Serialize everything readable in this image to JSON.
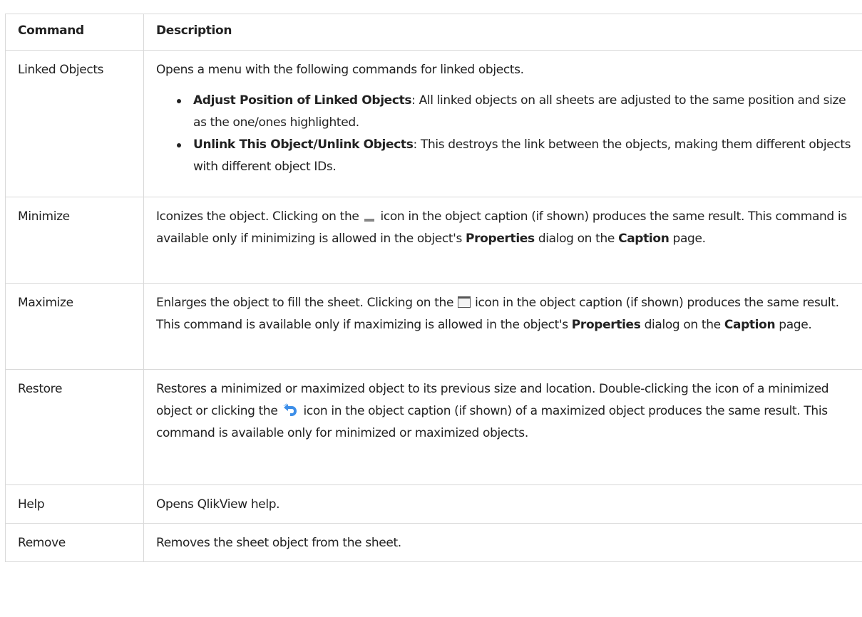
{
  "table": {
    "headers": {
      "command": "Command",
      "description": "Description"
    },
    "rows": {
      "linked": {
        "command": "Linked Objects",
        "intro": "Opens a menu with the following commands for linked objects.",
        "bullet1_term": "Adjust Position of Linked Objects",
        "bullet1_text": ": All linked objects on all sheets are adjusted to the same position and size as the one/ones highlighted.",
        "bullet2_term": "Unlink This Object/Unlink Objects",
        "bullet2_text": ": This destroys the link between the objects, making them different objects with different object IDs."
      },
      "minimize": {
        "command": "Minimize",
        "text_a": "Iconizes the object. Clicking on the",
        "text_b": "icon in the object caption (if shown) produces the same result. This command is available only if minimizing is allowed in the object's",
        "term1": "Properties",
        "text_c": "dialog on the",
        "term2": "Caption",
        "text_d": "page.",
        "icon": "minimize-icon"
      },
      "maximize": {
        "command": "Maximize",
        "text_a": "Enlarges the object to fill the sheet. Clicking on the",
        "text_b": "icon in the object caption (if shown) produces the same result. This command is available only if maximizing is allowed in the object's",
        "term1": "Properties",
        "text_c": "dialog on the",
        "term2": "Caption",
        "text_d": "page.",
        "icon": "maximize-icon"
      },
      "restore": {
        "command": "Restore",
        "text_a": "Restores a minimized or maximized object to its previous size and location. Double-clicking the icon of a minimized object or clicking the",
        "text_b": "icon in the object caption (if shown) of a maximized object produces the same result. This command is available only for minimized or maximized objects.",
        "icon": "restore-icon"
      },
      "help": {
        "command": "Help",
        "description": "Opens QlikView help."
      },
      "remove": {
        "command": "Remove",
        "description": "Removes the sheet object from the sheet."
      }
    }
  },
  "colors": {
    "border": "#d9d9d9",
    "text": "#222222",
    "restore_icon": "#3d8ee8"
  }
}
